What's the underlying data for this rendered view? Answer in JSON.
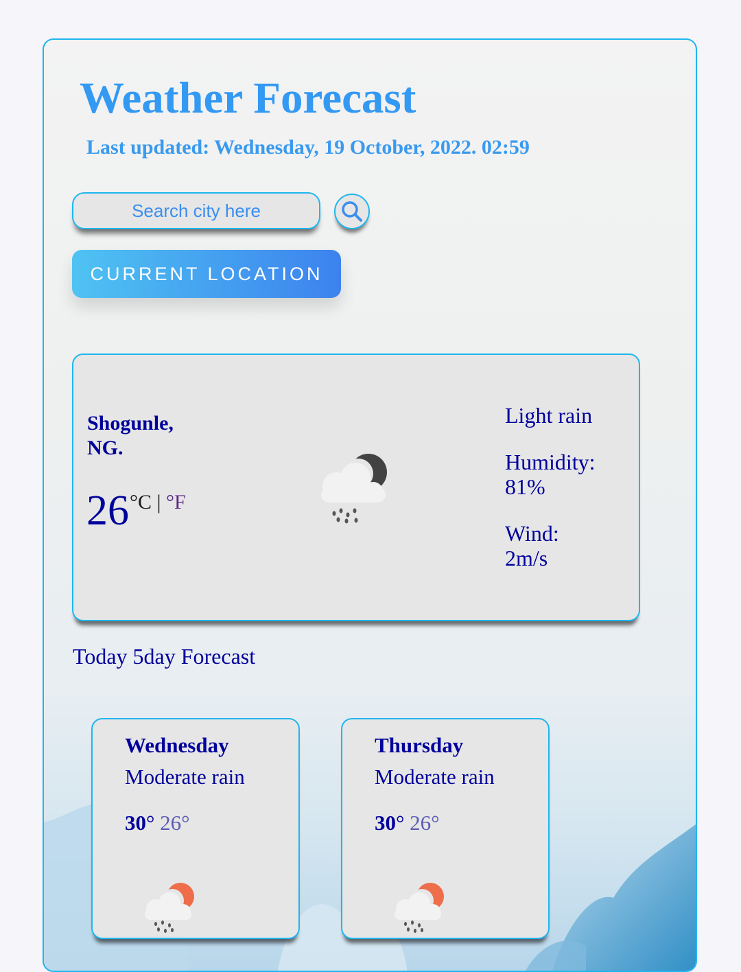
{
  "header": {
    "title": "Weather Forecast",
    "last_updated": "Last updated: Wednesday, 19 October, 2022. 02:59"
  },
  "search": {
    "placeholder": "Search city here",
    "button_icon": "search-icon"
  },
  "current_location_label": "CURRENT LOCATION",
  "current": {
    "city": "Shogunle,",
    "country": "NG.",
    "temperature": "26",
    "unit_c": "°C",
    "unit_sep": " | ",
    "unit_f": "°F",
    "icon": "night-rain-icon",
    "description": "Light rain",
    "humidity_label": "Humidity:",
    "humidity_value": "81%",
    "wind_label": "Wind:",
    "wind_value": "2m/s"
  },
  "forecast": {
    "label": "Today 5day Forecast",
    "days": [
      {
        "day": "Wednesday",
        "description": "Moderate rain",
        "max": "30",
        "min": "26°",
        "icon": "day-rain-icon"
      },
      {
        "day": "Thursday",
        "description": "Moderate rain",
        "max": "30",
        "min": "26°",
        "icon": "day-rain-icon"
      }
    ]
  },
  "colors": {
    "accent": "#3399f3",
    "border": "#1fb6ef",
    "text_dark_blue": "#00009c",
    "card_bg": "#e6e6e6"
  }
}
